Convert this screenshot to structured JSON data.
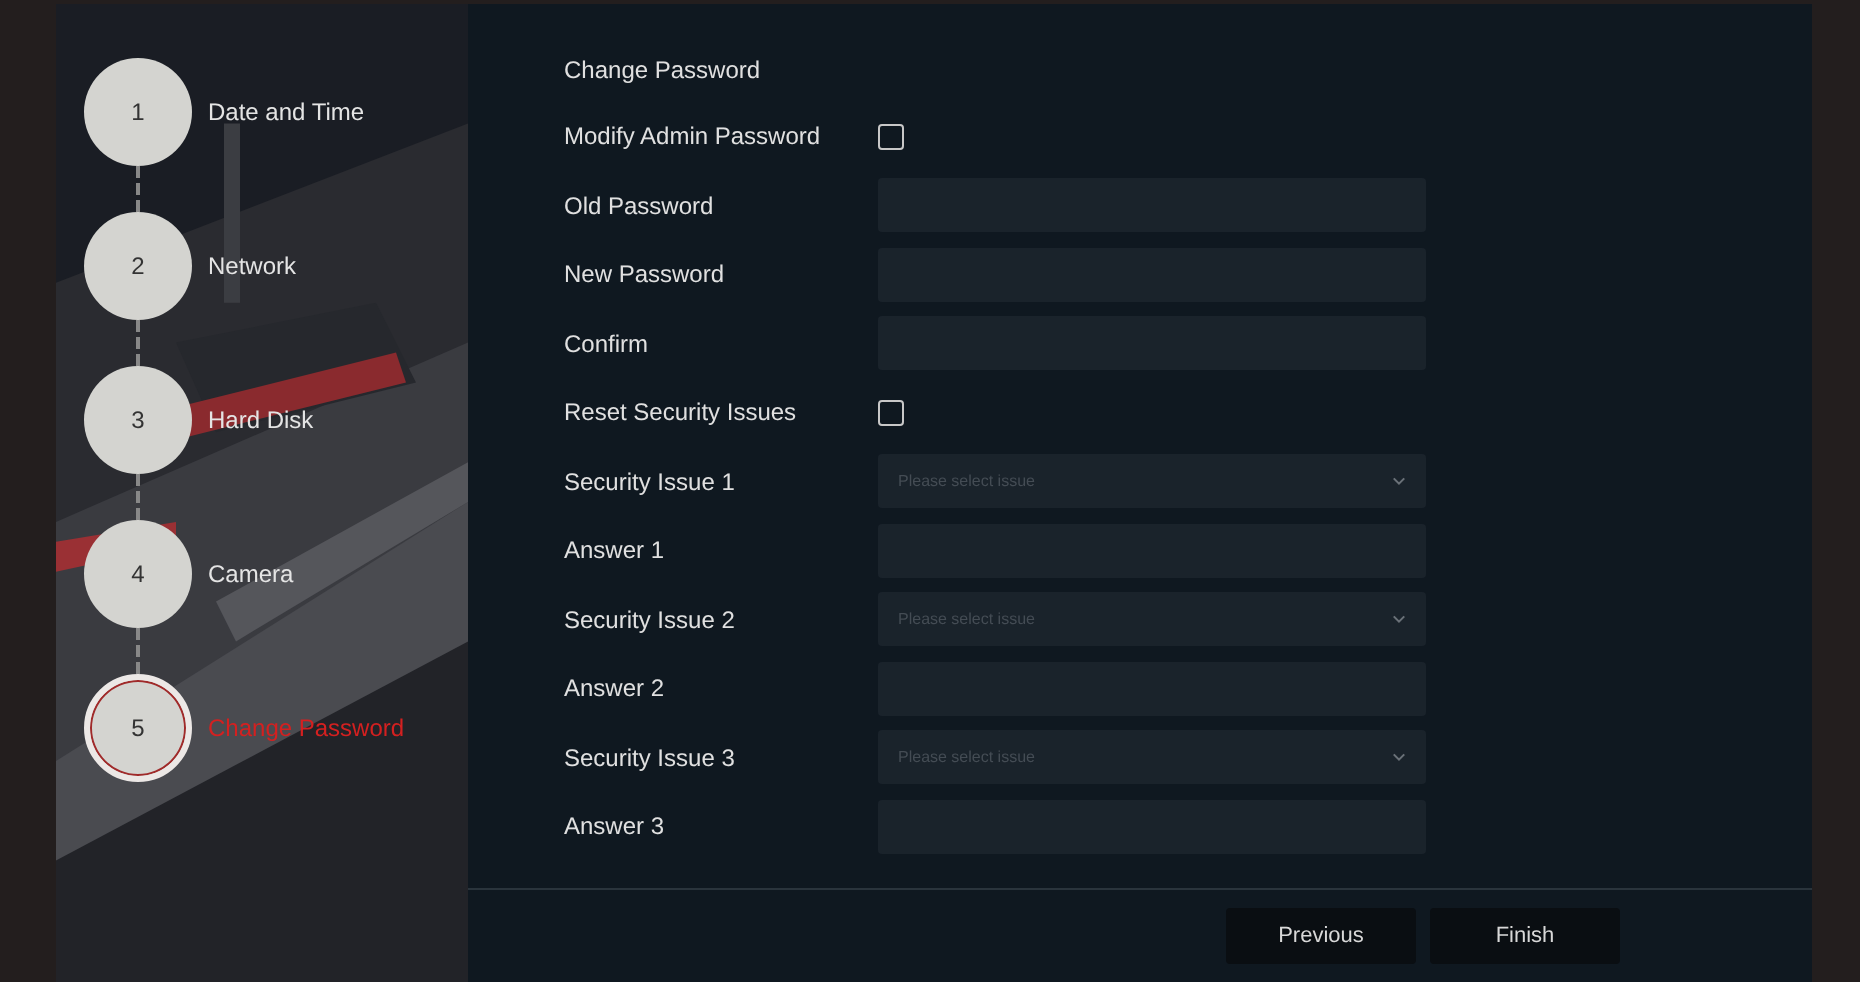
{
  "steps": [
    {
      "number": "1",
      "label": "Date and Time",
      "selected": false
    },
    {
      "number": "2",
      "label": "Network",
      "selected": false
    },
    {
      "number": "3",
      "label": "Hard Disk",
      "selected": false
    },
    {
      "number": "4",
      "label": "Camera",
      "selected": false
    },
    {
      "number": "5",
      "label": "Change Password",
      "selected": true
    }
  ],
  "form": {
    "title": "Change Password",
    "rows": [
      {
        "kind": "checkbox",
        "label": "Modify Admin Password",
        "checked": false
      },
      {
        "kind": "input",
        "label": "Old Password"
      },
      {
        "kind": "input",
        "label": "New Password"
      },
      {
        "kind": "input",
        "label": "Confirm"
      },
      {
        "kind": "checkbox",
        "label": "Reset Security Issues",
        "checked": false
      },
      {
        "kind": "select",
        "label": "Security Issue 1",
        "placeholder": "Please select issue"
      },
      {
        "kind": "input",
        "label": "Answer 1"
      },
      {
        "kind": "select",
        "label": "Security Issue 2",
        "placeholder": "Please select issue"
      },
      {
        "kind": "input",
        "label": "Answer 2"
      },
      {
        "kind": "select",
        "label": "Security Issue 3",
        "placeholder": "Please select issue"
      },
      {
        "kind": "input",
        "label": "Answer 3"
      }
    ]
  },
  "buttons": [
    "Previous",
    "Finish"
  ]
}
